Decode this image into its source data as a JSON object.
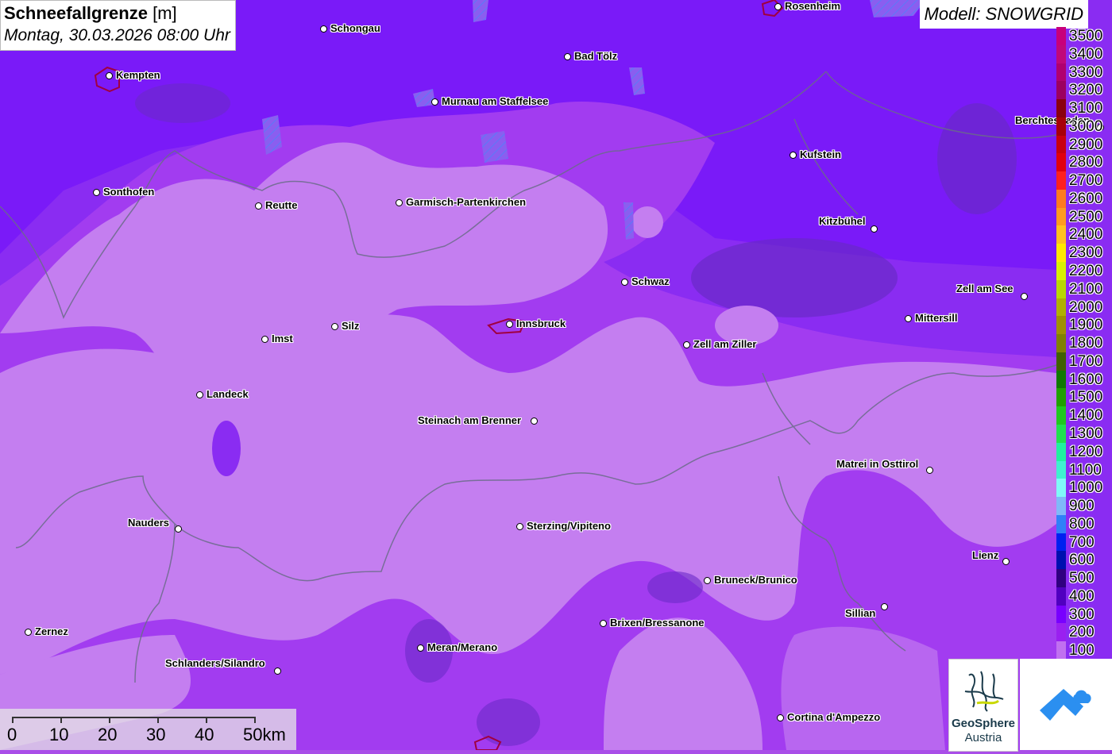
{
  "title": {
    "main": "Schneefallgrenze",
    "unit": "[m]",
    "datetime": "Montag, 30.03.2026 08:00 Uhr"
  },
  "model": "Modell: SNOWGRID",
  "legend": [
    {
      "label": "3500",
      "color": "#c8007a"
    },
    {
      "label": "3400",
      "color": "#c0087a"
    },
    {
      "label": "3300",
      "color": "#b00070"
    },
    {
      "label": "3200",
      "color": "#9c0060"
    },
    {
      "label": "3100",
      "color": "#8a0010"
    },
    {
      "label": "3000",
      "color": "#a80008"
    },
    {
      "label": "2900",
      "color": "#c80010"
    },
    {
      "label": "2800",
      "color": "#e00010"
    },
    {
      "label": "2700",
      "color": "#ff2020"
    },
    {
      "label": "2600",
      "color": "#ff7a20"
    },
    {
      "label": "2500",
      "color": "#ff9a20"
    },
    {
      "label": "2400",
      "color": "#ffc020"
    },
    {
      "label": "2300",
      "color": "#ffe800"
    },
    {
      "label": "2200",
      "color": "#d8f000"
    },
    {
      "label": "2100",
      "color": "#b8d800"
    },
    {
      "label": "2000",
      "color": "#b0b000"
    },
    {
      "label": "1900",
      "color": "#a09000"
    },
    {
      "label": "1800",
      "color": "#808000"
    },
    {
      "label": "1700",
      "color": "#406000"
    },
    {
      "label": "1600",
      "color": "#107800"
    },
    {
      "label": "1500",
      "color": "#20a000"
    },
    {
      "label": "1400",
      "color": "#20c820"
    },
    {
      "label": "1300",
      "color": "#20e050"
    },
    {
      "label": "1200",
      "color": "#20f0a0"
    },
    {
      "label": "1100",
      "color": "#40f0d0"
    },
    {
      "label": "1000",
      "color": "#80f8f8"
    },
    {
      "label": "900",
      "color": "#80b8f8"
    },
    {
      "label": "800",
      "color": "#3080f8"
    },
    {
      "label": "700",
      "color": "#0020f0"
    },
    {
      "label": "600",
      "color": "#0010b0"
    },
    {
      "label": "500",
      "color": "#300080"
    },
    {
      "label": "400",
      "color": "#5000c0"
    },
    {
      "label": "300",
      "color": "#7800ff"
    },
    {
      "label": "200",
      "color": "#9a20f0"
    },
    {
      "label": "100",
      "color": "#c070f0"
    }
  ],
  "cities": [
    {
      "name": "Rosenheim",
      "label_side": "right"
    },
    {
      "name": "Schongau",
      "label_side": "right"
    },
    {
      "name": "Bad Tölz",
      "label_side": "right"
    },
    {
      "name": "Kempten",
      "label_side": "right"
    },
    {
      "name": "Murnau am Staffelsee",
      "label_side": "right"
    },
    {
      "name": "Berchtesgaden",
      "label_side": "left"
    },
    {
      "name": "Kufstein",
      "label_side": "right"
    },
    {
      "name": "Sonthofen",
      "label_side": "right"
    },
    {
      "name": "Reutte",
      "label_side": "right"
    },
    {
      "name": "Garmisch-Partenkirchen",
      "label_side": "right"
    },
    {
      "name": "Kitzbühel",
      "label_side": "left"
    },
    {
      "name": "Schwaz",
      "label_side": "right"
    },
    {
      "name": "Zell am See",
      "label_side": "left"
    },
    {
      "name": "Mittersill",
      "label_side": "right"
    },
    {
      "name": "Innsbruck",
      "label_side": "right"
    },
    {
      "name": "Imst",
      "label_side": "right"
    },
    {
      "name": "Silz",
      "label_side": "right"
    },
    {
      "name": "Zell am Ziller",
      "label_side": "right"
    },
    {
      "name": "Landeck",
      "label_side": "right"
    },
    {
      "name": "Steinach am Brenner",
      "label_side": "left"
    },
    {
      "name": "Matrei in Osttirol",
      "label_side": "left"
    },
    {
      "name": "Nauders",
      "label_side": "left"
    },
    {
      "name": "Sterzing/Vipiteno",
      "label_side": "right"
    },
    {
      "name": "Lienz",
      "label_side": "left"
    },
    {
      "name": "Bruneck/Brunico",
      "label_side": "right"
    },
    {
      "name": "Sillian",
      "label_side": "left"
    },
    {
      "name": "Brixen/Bressanone",
      "label_side": "right"
    },
    {
      "name": "Zernez",
      "label_side": "right"
    },
    {
      "name": "Meran/Merano",
      "label_side": "right"
    },
    {
      "name": "Schlanders/Silandro",
      "label_side": "left"
    },
    {
      "name": "Cortina d'Ampezzo",
      "label_side": "right"
    }
  ],
  "scale": {
    "labels": [
      "0",
      "10",
      "20",
      "30",
      "40",
      "50km"
    ]
  },
  "logo": {
    "line1": "GeoSphere",
    "line2": "Austria"
  }
}
